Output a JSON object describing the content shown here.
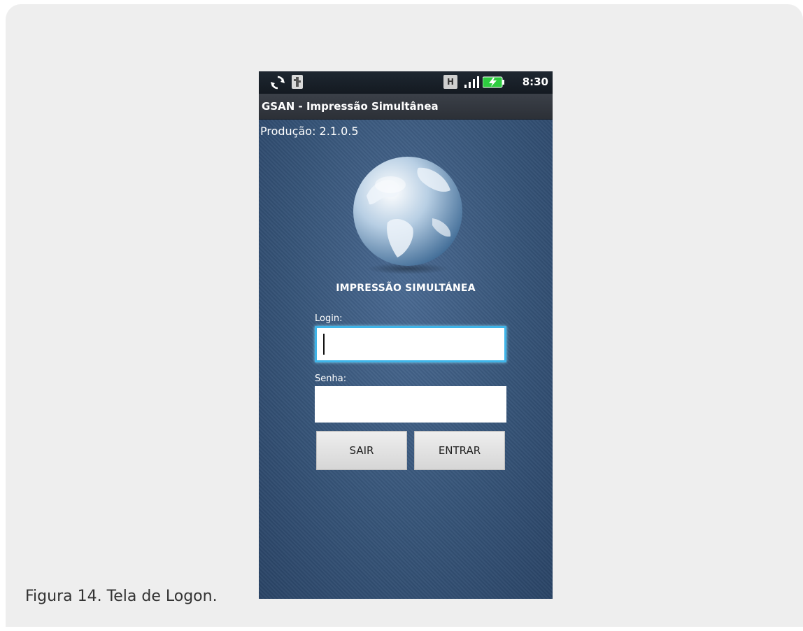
{
  "status_bar": {
    "time": "8:30",
    "icons": [
      "sync-icon",
      "usb-icon",
      "h-network-icon",
      "signal-icon",
      "battery-charging-icon"
    ],
    "h_label": "H"
  },
  "app": {
    "title": "GSAN - Impressão Simultânea",
    "version": "Produção: 2.1.0.5",
    "brand": "IMPRESSÃO SIMULTÁNEA",
    "logo": "globe-icon"
  },
  "form": {
    "login_label": "Login:",
    "login_value": "",
    "senha_label": "Senha:",
    "senha_value": "",
    "sair_label": "SAIR",
    "entrar_label": "ENTRAR"
  },
  "caption": "Figura 14. Tela de Logon.",
  "colors": {
    "background": "#eeeeee",
    "screen": "#365478",
    "focus": "#3fb4e8",
    "battery": "#2ecc40"
  }
}
